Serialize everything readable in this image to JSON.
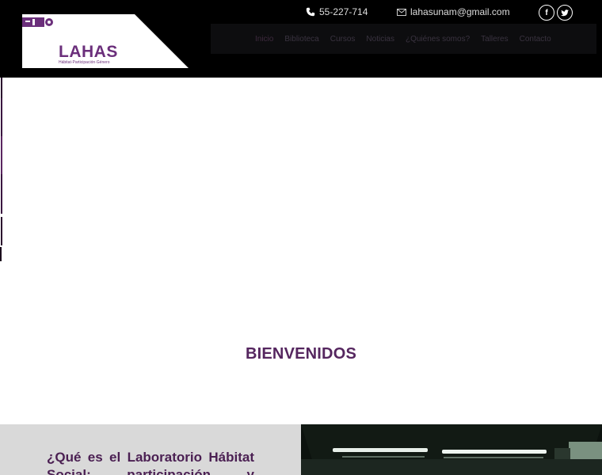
{
  "header": {
    "logo": {
      "name": "LAHAS",
      "tagline": "Hábitat·Participación·Género"
    },
    "phone": "55-227-714",
    "email": "lahasunam@gmail.com",
    "social": [
      {
        "label": "f",
        "icon": "facebook-icon"
      },
      {
        "label": "t",
        "icon": "twitter-icon"
      }
    ]
  },
  "nav": {
    "items": [
      "Inicio",
      "Biblioteca",
      "Cursos",
      "Noticias",
      "¿Quiénes somos?",
      "Talleres",
      "Contacto"
    ],
    "active": "Inicio"
  },
  "hero": {
    "title": "BIENVENIDOS"
  },
  "about": {
    "heading": "¿Qué es el Laboratorio Hábitat Social: participación y"
  },
  "colors": {
    "brand": "#55265f",
    "header_bg": "#000000",
    "nav_bg": "#0d0d0f"
  }
}
